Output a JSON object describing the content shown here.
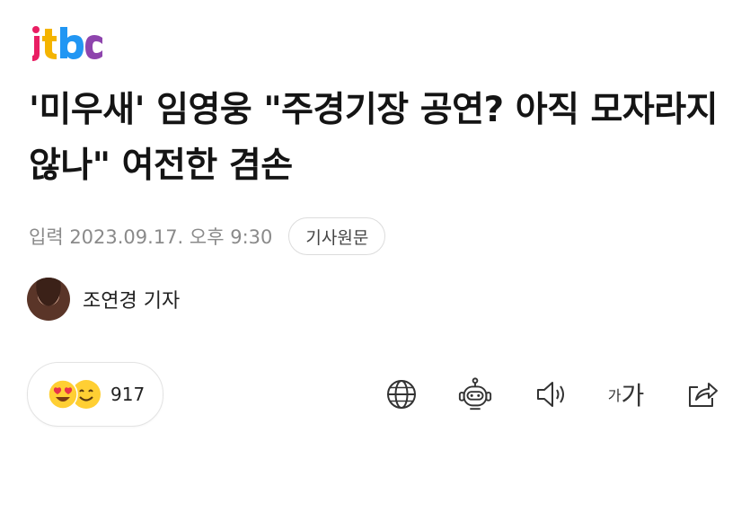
{
  "brand": {
    "letters": [
      "j",
      "t",
      "b",
      "c"
    ],
    "colors": [
      "#e91e63",
      "#f4b400",
      "#2196f3",
      "#8e44ad"
    ]
  },
  "article": {
    "title": "'미우새' 임영웅 \"주경기장 공연? 아직 모자라지 않나\" 여전한 겸손",
    "date_label": "입력 2023.09.17. 오후 9:30",
    "source_button": "기사원문",
    "reporter": "조연경 기자"
  },
  "reactions": {
    "count": "917",
    "emojis": [
      "heart-eyes",
      "smiling"
    ]
  },
  "toolbar": {
    "icons": [
      "globe-icon",
      "robot-icon",
      "speaker-icon",
      "font-size-icon",
      "share-icon"
    ],
    "font_size_small": "가",
    "font_size_large": "가"
  }
}
